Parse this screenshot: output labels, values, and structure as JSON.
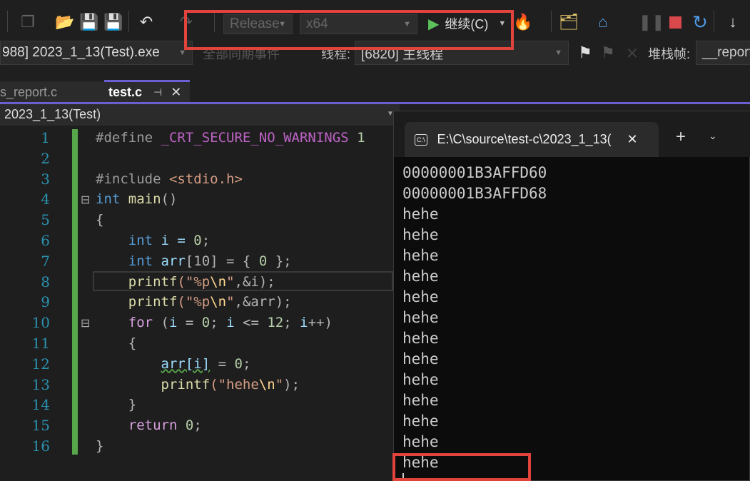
{
  "toolbar": {
    "config": "Release",
    "platform": "x64",
    "continue_label": "继续(C)",
    "icons": [
      "new-project-icon",
      "open-folder-icon",
      "save-icon",
      "save-all-icon",
      "undo-icon",
      "redo-icon",
      "play-icon",
      "hot-reload-icon",
      "find-folder-icon",
      "home-window-icon",
      "pause-icon",
      "stop-icon",
      "restart-icon",
      "step-into-icon"
    ]
  },
  "debugbar": {
    "process": "988] 2023_1_13(Test).exe",
    "events": "全部同期事件",
    "thread_label": "线程:",
    "thread": "[6820] 主线程",
    "stack_label": "堆栈帧:",
    "stack": "__report"
  },
  "tabs": [
    {
      "label": "s_report.c"
    },
    {
      "label": "test.c",
      "active": true
    }
  ],
  "navbar": {
    "scope": "2023_1_13(Test)"
  },
  "editor": {
    "lines": [
      [
        [
          "#define ",
          "pp"
        ],
        [
          "_CRT_SECURE_NO_WARNINGS",
          "macro"
        ],
        [
          " 1",
          "num"
        ]
      ],
      [],
      [
        [
          "#include ",
          "pp"
        ],
        [
          "<stdio.h>",
          "str"
        ]
      ],
      [
        [
          "int",
          "kw"
        ],
        [
          " ",
          ""
        ],
        [
          "main",
          "fn"
        ],
        [
          "()",
          "p"
        ]
      ],
      [
        [
          "{",
          "p"
        ]
      ],
      [
        [
          "    ",
          ""
        ],
        [
          "int",
          "kw"
        ],
        [
          " i = ",
          "var"
        ],
        [
          "0",
          "num"
        ],
        [
          ";",
          "p"
        ]
      ],
      [
        [
          "    ",
          ""
        ],
        [
          "int",
          "kw"
        ],
        [
          " arr",
          "var"
        ],
        [
          "[10] = { ",
          "p"
        ],
        [
          "0",
          "num"
        ],
        [
          " };",
          "p"
        ]
      ],
      [
        [
          "    ",
          ""
        ],
        [
          "printf",
          "fn"
        ],
        [
          "(\"%p",
          "str"
        ],
        [
          "\\n",
          "esc"
        ],
        [
          "\"",
          "str"
        ],
        [
          ",&i);",
          "p"
        ]
      ],
      [
        [
          "    ",
          ""
        ],
        [
          "printf",
          "fn"
        ],
        [
          "(\"%p",
          "str"
        ],
        [
          "\\n",
          "esc"
        ],
        [
          "\"",
          "str"
        ],
        [
          ",&arr);",
          "p"
        ]
      ],
      [
        [
          "    ",
          ""
        ],
        [
          "for",
          "ctl"
        ],
        [
          " (",
          "p"
        ],
        [
          "i",
          "var"
        ],
        [
          " = ",
          "p"
        ],
        [
          "0",
          "num"
        ],
        [
          "; ",
          "p"
        ],
        [
          "i",
          "var"
        ],
        [
          " <= ",
          "p"
        ],
        [
          "12",
          "num"
        ],
        [
          "; ",
          "p"
        ],
        [
          "i",
          "var"
        ],
        [
          "++)",
          "p"
        ]
      ],
      [
        [
          "    {",
          "p"
        ]
      ],
      [
        [
          "        ",
          ""
        ],
        [
          "arr[i]",
          "var"
        ],
        [
          " = ",
          "p"
        ],
        [
          "0",
          "num"
        ],
        [
          ";",
          "p"
        ]
      ],
      [
        [
          "        ",
          ""
        ],
        [
          "printf",
          "fn"
        ],
        [
          "(\"hehe",
          "str"
        ],
        [
          "\\n",
          "esc"
        ],
        [
          "\"",
          "str"
        ],
        [
          ");",
          "p"
        ]
      ],
      [
        [
          "    }",
          "p"
        ]
      ],
      [
        [
          "    ",
          ""
        ],
        [
          "return",
          "ctl"
        ],
        [
          " ",
          "p"
        ],
        [
          "0",
          "num"
        ],
        [
          ";",
          "p"
        ]
      ],
      [
        [
          "}",
          "p"
        ]
      ]
    ]
  },
  "terminal": {
    "tab_title": "E:\\C\\source\\test-c\\2023_1_13(",
    "output": [
      "00000001B3AFFD60",
      "00000001B3AFFD68",
      "hehe",
      "hehe",
      "hehe",
      "hehe",
      "hehe",
      "hehe",
      "hehe",
      "hehe",
      "hehe",
      "hehe",
      "hehe",
      "hehe",
      "hehe"
    ]
  },
  "colors": {
    "accent": "#6c5fd3",
    "highlight": "#e0443c",
    "change_bar": "#57a64a"
  }
}
